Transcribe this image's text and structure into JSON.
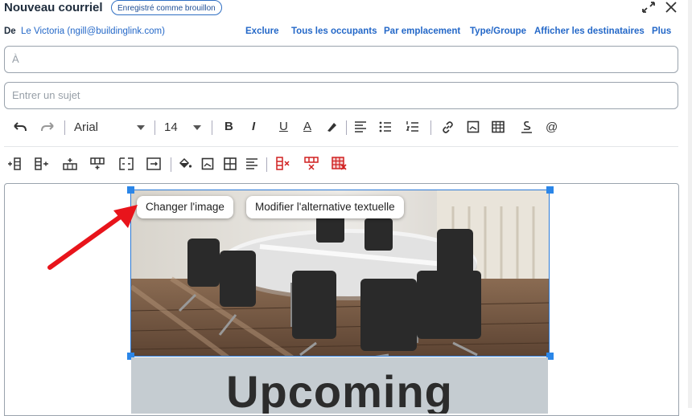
{
  "header": {
    "title": "Nouveau courriel",
    "draft_badge": "Enregistré comme brouillon"
  },
  "from": {
    "label": "De",
    "value": "Le Victoria (ngill@buildinglink.com)"
  },
  "recipient_links": [
    "Exclure",
    "Tous les occupants",
    "Par emplacement",
    "Type/Groupe",
    "Afficher les destinataires",
    "Plus"
  ],
  "to_field": {
    "placeholder": "À"
  },
  "subject_field": {
    "placeholder": "Entrer un sujet"
  },
  "toolbar": {
    "font_family": "Arial",
    "font_size": "14",
    "bold": "B",
    "italic": "I",
    "underline": "U",
    "font_color": "A",
    "special_char": "@"
  },
  "image_popup": {
    "change_image": "Changer l'image",
    "alt_text": "Modifier l'alternative textuelle"
  },
  "banner": {
    "text": "Upcoming"
  },
  "colors": {
    "accent": "#2468c8",
    "selection": "#2b86e8",
    "arrow": "#e8141b",
    "delete_icons": "#d02020"
  }
}
